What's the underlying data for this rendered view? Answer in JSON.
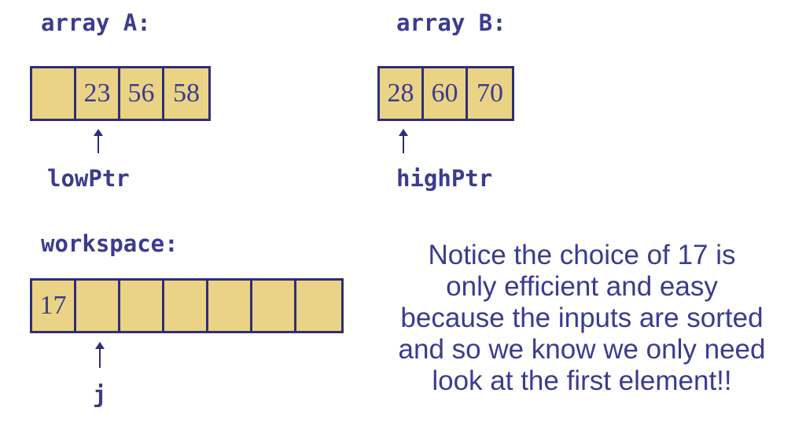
{
  "array_a": {
    "label": "array A:",
    "cells": [
      "",
      "23",
      "56",
      "58"
    ],
    "pointer": "lowPtr"
  },
  "array_b": {
    "label": "array B:",
    "cells": [
      "28",
      "60",
      "70"
    ],
    "pointer": "highPtr"
  },
  "workspace": {
    "label": "workspace:",
    "cells": [
      "17",
      "",
      "",
      "",
      "",
      "",
      ""
    ],
    "pointer": "j"
  },
  "note": [
    "Notice the choice of 17 is",
    "only efficient and easy",
    "because the inputs are sorted",
    "and so we know we only need",
    "look at the first element!!"
  ],
  "colors": {
    "text": "#3b3b8f",
    "cell_fill": "#ead385",
    "border": "#2e2e7a"
  }
}
